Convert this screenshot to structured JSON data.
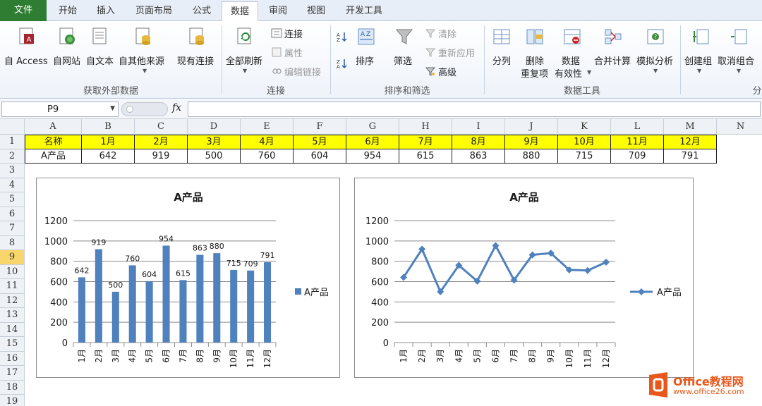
{
  "tabs": [
    "文件",
    "开始",
    "插入",
    "页面布局",
    "公式",
    "数据",
    "审阅",
    "视图",
    "开发工具"
  ],
  "ribbon": {
    "external": {
      "access": "自 Access",
      "web": "自网站",
      "text": "自文本",
      "other": "自其他来源",
      "existing": "现有连接",
      "label": "获取外部数据"
    },
    "conn": {
      "refresh": "全部刷新",
      "connections": "连接",
      "properties": "属性",
      "editlinks": "编辑链接",
      "label": "连接"
    },
    "sort": {
      "sort": "排序",
      "filter": "筛选",
      "clear": "清除",
      "reapply": "重新应用",
      "advanced": "高级",
      "label": "排序和筛选"
    },
    "tools": {
      "split": "分列",
      "remdup1": "删除",
      "remdup2": "重复项",
      "valid1": "数据",
      "valid2": "有效性",
      "consol": "合并计算",
      "whatif": "模拟分析",
      "label": "数据工具"
    },
    "outline": {
      "group": "创建组",
      "ungroup": "取消组合",
      "label": "分"
    }
  },
  "formula": {
    "namebox": "P9",
    "fx": "fx",
    "value": ""
  },
  "columns": [
    "A",
    "B",
    "C",
    "D",
    "E",
    "F",
    "G",
    "H",
    "I",
    "J",
    "K",
    "L",
    "M",
    "N"
  ],
  "rows": [
    "1",
    "2",
    "3",
    "4",
    "5",
    "6",
    "7",
    "8",
    "9",
    "10",
    "11",
    "12",
    "13",
    "14",
    "15",
    "16",
    "17",
    "18",
    "19"
  ],
  "selected_row": "9",
  "table": {
    "header": [
      "名称",
      "1月",
      "2月",
      "3月",
      "4月",
      "5月",
      "6月",
      "7月",
      "8月",
      "9月",
      "10月",
      "11月",
      "12月"
    ],
    "row": [
      "A产品",
      "642",
      "919",
      "500",
      "760",
      "604",
      "954",
      "615",
      "863",
      "880",
      "715",
      "709",
      "791"
    ]
  },
  "colors": {
    "series": "#4f81bd",
    "header_fill": "#ffff00",
    "watermark": "#e8581c"
  },
  "chart_data": [
    {
      "type": "bar",
      "title": "A产品",
      "categories": [
        "1月",
        "2月",
        "3月",
        "4月",
        "5月",
        "6月",
        "7月",
        "8月",
        "9月",
        "10月",
        "11月",
        "12月"
      ],
      "series": [
        {
          "name": "A产品",
          "values": [
            642,
            919,
            500,
            760,
            604,
            954,
            615,
            863,
            880,
            715,
            709,
            791
          ]
        }
      ],
      "yticks": [
        "0",
        "200",
        "400",
        "600",
        "800",
        "1000",
        "1200"
      ],
      "ylim": [
        0,
        1200
      ],
      "data_labels": true,
      "legend": "right",
      "grid": true
    },
    {
      "type": "line",
      "title": "A产品",
      "categories": [
        "1月",
        "2月",
        "3月",
        "4月",
        "5月",
        "6月",
        "7月",
        "8月",
        "9月",
        "10月",
        "11月",
        "12月"
      ],
      "series": [
        {
          "name": "A产品",
          "values": [
            642,
            919,
            500,
            760,
            604,
            954,
            615,
            863,
            880,
            715,
            709,
            791
          ]
        }
      ],
      "yticks": [
        "0",
        "200",
        "400",
        "600",
        "800",
        "1000",
        "1200"
      ],
      "ylim": [
        0,
        1200
      ],
      "data_labels": false,
      "legend": "right",
      "grid": true
    }
  ],
  "watermark": {
    "brand": "Office教程网",
    "url": "www.office26.com"
  }
}
